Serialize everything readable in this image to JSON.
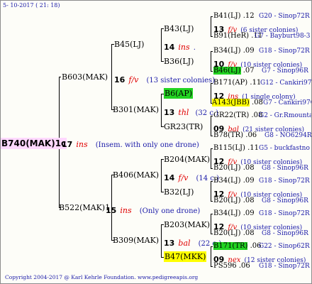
{
  "date": "5- 10-2017 ( 21: 18)",
  "footer": "Copyright 2004-2017 @ Karl Kehrle Foundation.   www.pedigreeapis.org",
  "root": {
    "label": "B740(MAK)1c",
    "gen": "17",
    "ins": "ins",
    "note": "(Insem. with only one drone)"
  },
  "sire": {
    "label": "B603(MAK)",
    "gen": "16",
    "ins": "f/v",
    "note": "(13 sister colonies)"
  },
  "dam": {
    "label": "B522(MAK)1",
    "gen": "15",
    "ins": "ins",
    "note": "(Only one drone)"
  },
  "sire_sire": {
    "label": "B45(LJ)",
    "gen": "14",
    "ins": "ins",
    "note": "."
  },
  "sire_dam": {
    "label": "B301(MAK)",
    "gen": "13",
    "ins": "thl",
    "note": "(32 c.)"
  },
  "dam_sire": {
    "label": "B406(MAK)",
    "gen": "14",
    "ins": "f/v",
    "note": "(14 c.)"
  },
  "dam_dam": {
    "label": "B309(MAK)",
    "gen": "13",
    "ins": "bal",
    "note": "(22 c.)"
  },
  "g3": {
    "b43": "B43(LJ)",
    "b36": "B36(LJ)",
    "b6": "B6(AP)",
    "gr23": "GR23(TR)",
    "b204": "B204(MAK)",
    "b32": "B32(LJ)",
    "b203": "B203(MAK)",
    "b47": "B47(MKK)"
  },
  "g4": [
    {
      "top": "B41(LJ)",
      "top_v": ".12",
      "top_src": "G20 - Sinop72R",
      "gen": "13",
      "ins": "f/v",
      "note": "(6 sister colonies)",
      "bot": "B91(HeR)",
      "bot_v": ".11",
      "bot_src": "G7 - Bayburt98-3"
    },
    {
      "top": "B34(LJ)",
      "top_v": ".09",
      "top_src": "G18 - Sinop72R",
      "gen": "10",
      "ins": "f/v",
      "note": "(10 sister colonies)",
      "bot": "B46(LJ)",
      "bot_v": ".07",
      "bot_src": "G7 - Sinop96R"
    },
    {
      "top": "B171(AP)",
      "top_v": ".11",
      "top_src": "G12 - Cankiri97Q",
      "gen": "12",
      "ins": "ins",
      "note": "(1 single colony)",
      "bot": "A143(JBB)",
      "bot_v": ".08",
      "bot_src": "G7 - Cankiri97Q"
    },
    {
      "top": "GR22(TR)",
      "top_v": ".08",
      "top_src": "G2 - Gr.Rmounta",
      "gen": "09",
      "ins": "bal",
      "note": "(21 sister colonies)",
      "bot": "B78(TR)",
      "bot_v": ".06",
      "bot_src": "G8 - NO6294R"
    },
    {
      "top": "B115(LJ)",
      "top_v": ".11",
      "top_src": "G5 - buckfastno",
      "gen": "12",
      "ins": "f/v",
      "note": "(10 sister colonies)",
      "bot": "B20(LJ)",
      "bot_v": ".08",
      "bot_src": "G8 - Sinop96R"
    },
    {
      "top": "B34(LJ)",
      "top_v": ".09",
      "top_src": "G18 - Sinop72R",
      "gen": "12",
      "ins": "f/v",
      "note": "(10 sister colonies)",
      "bot": "B20(LJ)",
      "bot_v": ".08",
      "bot_src": "G8 - Sinop96R"
    },
    {
      "top": "B34(LJ)",
      "top_v": ".09",
      "top_src": "G18 - Sinop72R",
      "gen": "12",
      "ins": "f/v",
      "note": "(10 sister colonies)",
      "bot": "B20(LJ)",
      "bot_v": ".08",
      "bot_src": "G8 - Sinop96R"
    },
    {
      "top": "B171(TR)",
      "top_v": ".06",
      "top_src": "G22 - Sinop62R",
      "gen": "09",
      "ins": "nex",
      "note": "(12 sister colonies)",
      "bot": "PS596",
      "bot_v": ".06",
      "bot_src": "G18 - Sinop72R"
    }
  ],
  "colors": {
    "green": "#22d322",
    "yellow": "#ffff00",
    "pink": "#ffd8ff",
    "blue": "#1a1aa8",
    "red": "#e00000"
  }
}
